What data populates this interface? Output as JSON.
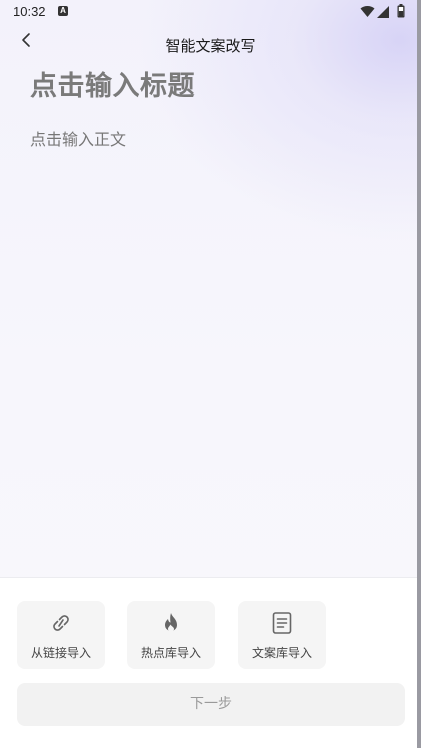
{
  "status_bar": {
    "time": "10:32",
    "notification_icon": "a-badge-icon",
    "icons": [
      "wifi-icon",
      "signal-icon",
      "battery-icon"
    ]
  },
  "header": {
    "back_icon": "chevron-left-icon",
    "title": "智能文案改写"
  },
  "editor": {
    "title_placeholder": "点击输入标题",
    "body_placeholder": "点击输入正文"
  },
  "import_actions": [
    {
      "label": "从链接导入",
      "icon": "link-icon"
    },
    {
      "label": "热点库导入",
      "icon": "flame-icon"
    },
    {
      "label": "文案库导入",
      "icon": "document-icon"
    }
  ],
  "next_button": {
    "label": "下一步"
  },
  "colors": {
    "background_top": "#e0ddf7",
    "title_placeholder": "#7a7a7a",
    "button_bg": "#f5f5f5",
    "next_text": "#9a9a9a"
  }
}
